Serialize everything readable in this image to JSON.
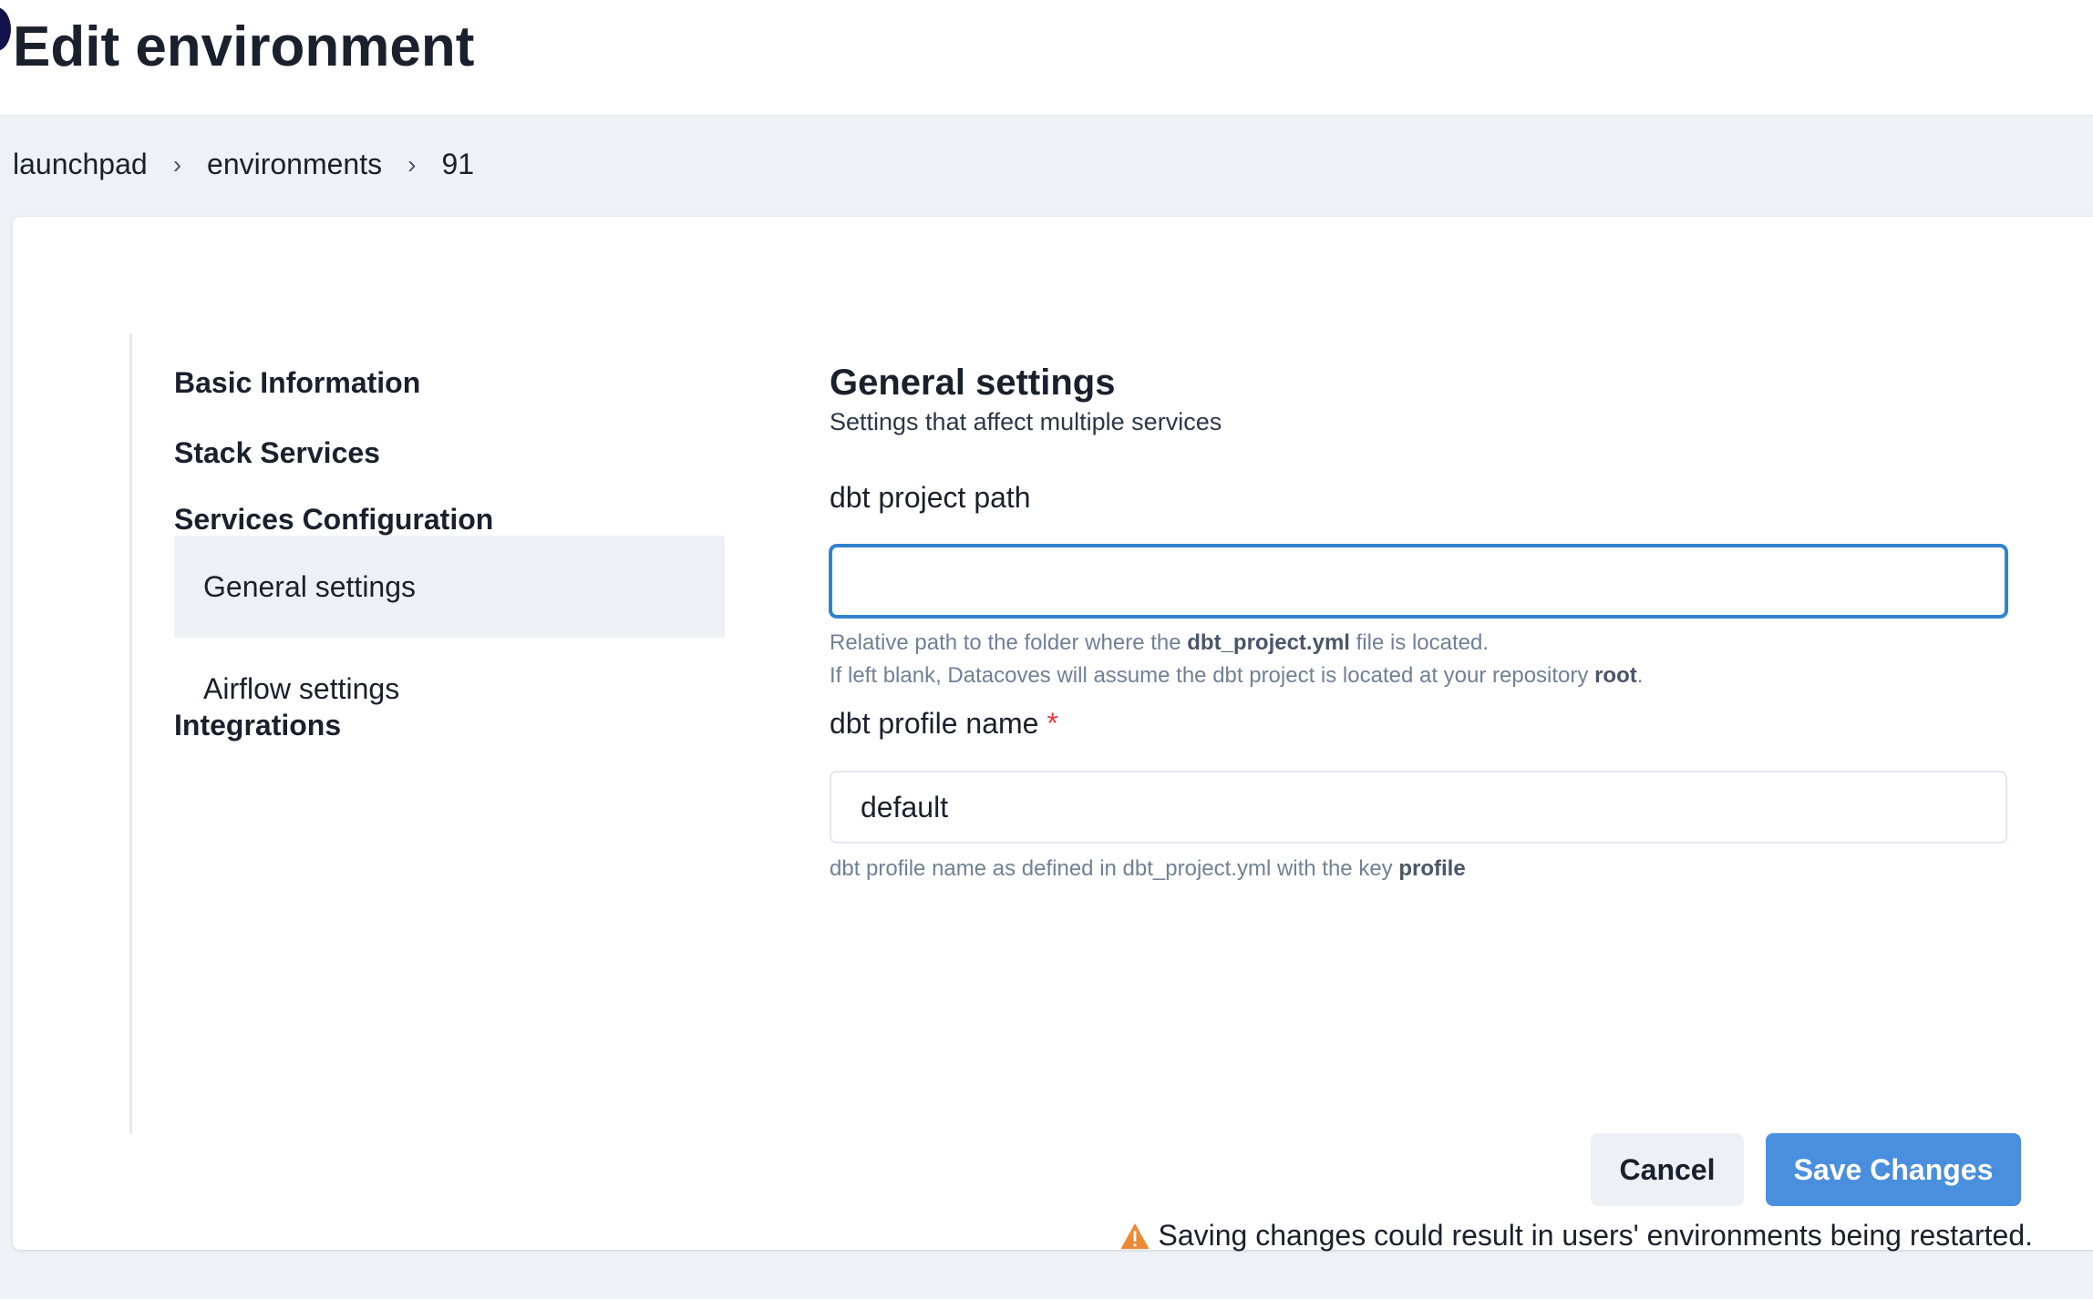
{
  "header": {
    "title": "Edit environment"
  },
  "breadcrumb": {
    "items": [
      "launchpad",
      "environments",
      "91"
    ],
    "separator": "›"
  },
  "nav": {
    "items": [
      {
        "label": "Basic Information"
      },
      {
        "label": "Stack Services"
      },
      {
        "label": "Services Configuration",
        "expanded": true
      },
      {
        "label": "Integrations"
      }
    ],
    "sub_items": [
      {
        "label": "General settings",
        "active": true
      },
      {
        "label": "Airflow settings",
        "active": false
      }
    ]
  },
  "section": {
    "title": "General settings",
    "subtitle": "Settings that affect multiple services"
  },
  "fields": {
    "project_path": {
      "label": "dbt project path",
      "value": "",
      "placeholder": "",
      "help_line1_pre": "Relative path to the folder where the ",
      "help_line1_bold": "dbt_project.yml",
      "help_line1_post": " file is located.",
      "help_line2_pre": "If left blank, Datacoves will assume the dbt project is located at your repository ",
      "help_line2_bold": "root",
      "help_line2_post": "."
    },
    "profile_name": {
      "label": "dbt profile name",
      "required_mark": "*",
      "value": "default",
      "help_pre": "dbt profile name as defined in dbt_project.yml with the key ",
      "help_bold": "profile"
    }
  },
  "actions": {
    "cancel_label": "Cancel",
    "save_label": "Save Changes",
    "warning_text": "Saving changes could result in users' environments being restarted."
  },
  "colors": {
    "accent": "#4a8fde",
    "focus_border": "#3182ce",
    "required": "#e53e3e",
    "warning_icon": "#ed8936",
    "page_bg": "#eef1f5"
  },
  "icons": {
    "chevron": "chevron-down-icon",
    "warning": "warning-triangle-icon"
  }
}
